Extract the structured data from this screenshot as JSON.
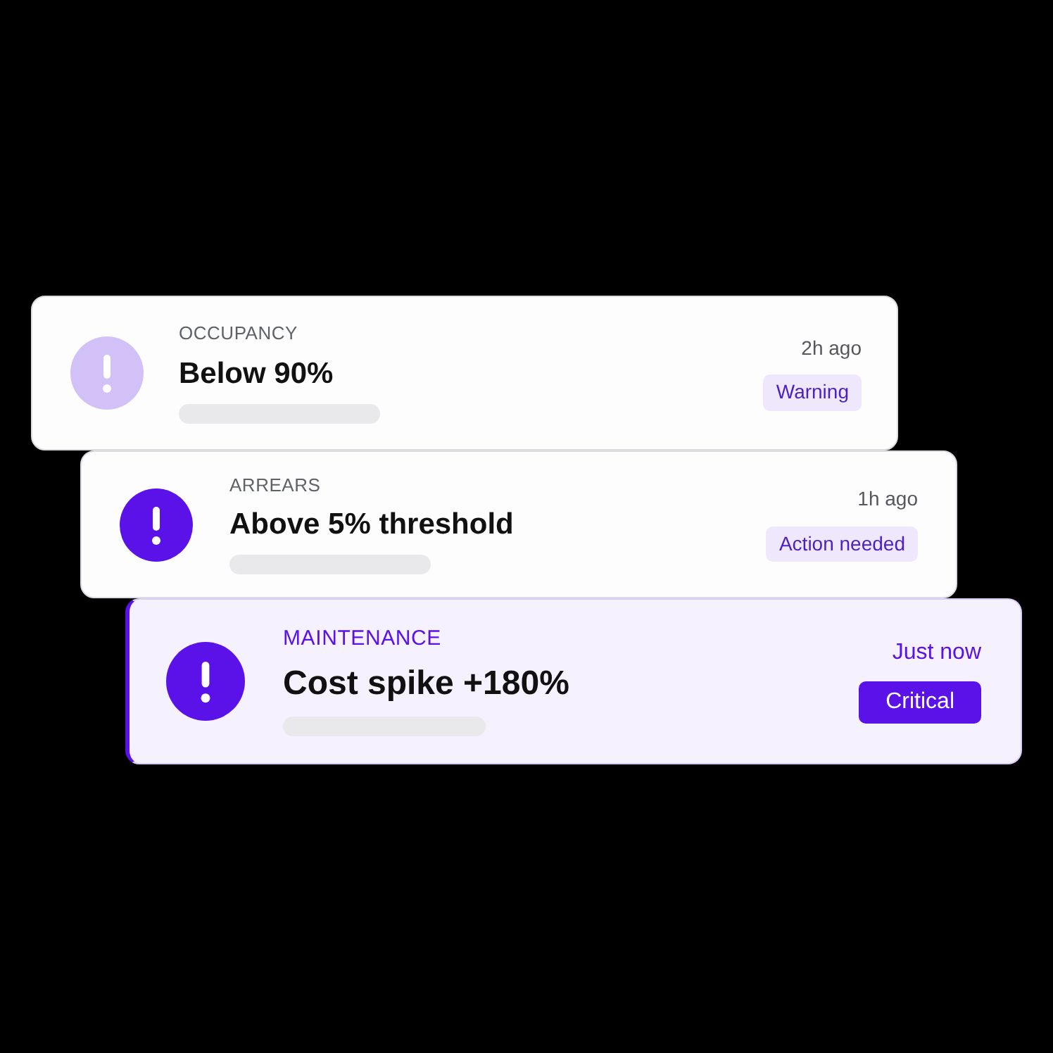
{
  "alerts": [
    {
      "kind": "warning",
      "category": "OCCUPANCY",
      "title": "Below 90%",
      "time": "2h ago",
      "badge": "Warning"
    },
    {
      "kind": "high",
      "category": "ARREARS",
      "title": "Above 5% threshold",
      "time": "1h ago",
      "badge": "Action needed"
    },
    {
      "kind": "critical",
      "category": "MAINTENANCE",
      "title": "Cost spike +180%",
      "time": "Just now",
      "badge": "Critical"
    }
  ]
}
